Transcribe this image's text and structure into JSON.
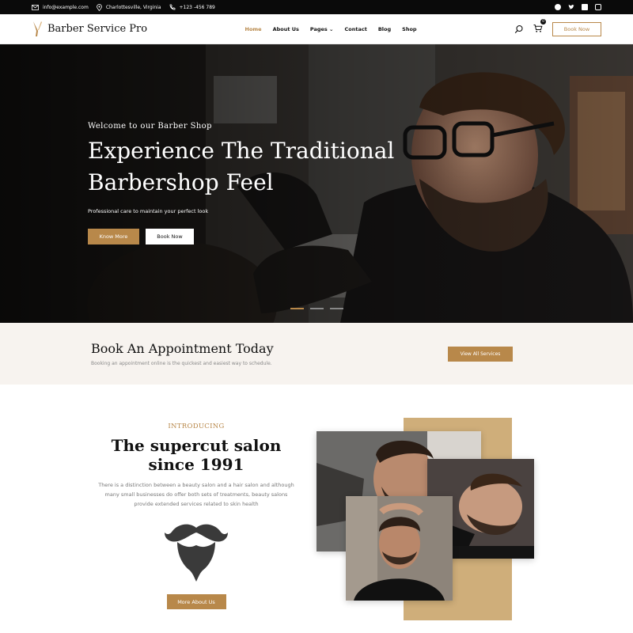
{
  "topbar": {
    "email": "info@example.com",
    "location": "Charlottesville, Virginia",
    "phone": "+123 -456 789",
    "social_icons": [
      "facebook-icon",
      "twitter-icon",
      "linkedin-icon",
      "instagram-icon"
    ]
  },
  "header": {
    "logo_text": "Barber Service Pro",
    "nav": [
      {
        "label": "Home",
        "active": true
      },
      {
        "label": "About Us"
      },
      {
        "label": "Pages ⌄"
      },
      {
        "label": "Contact"
      },
      {
        "label": "Blog"
      },
      {
        "label": "Shop"
      }
    ],
    "cart_count": "0",
    "book_button": "Book Now"
  },
  "hero": {
    "welcome": "Welcome to our Barber Shop",
    "title_line1": "Experience The Traditional",
    "title_line2": "Barbershop Feel",
    "subtitle": "Professional care to maintain your perfect look",
    "btn_primary": "Know More",
    "btn_secondary": "Book Now",
    "slides": 3,
    "active_slide": 1
  },
  "appointment": {
    "title": "Book An Appointment Today",
    "subtitle": "Booking an appointment online is the quickest and easiest way to schedule.",
    "button": "View All Services"
  },
  "intro": {
    "kicker": "INTRODUCING",
    "title": "The supercut salon since 1991",
    "description": "There is a distinction between a beauty salon and a hair salon and although many small businesses do offer both sets of treatments, beauty salons provide extended services related to skin health",
    "button": "More About Us"
  },
  "colors": {
    "accent": "#b8884a",
    "dark": "#0a0a0a",
    "band": "#f7f3ef"
  }
}
